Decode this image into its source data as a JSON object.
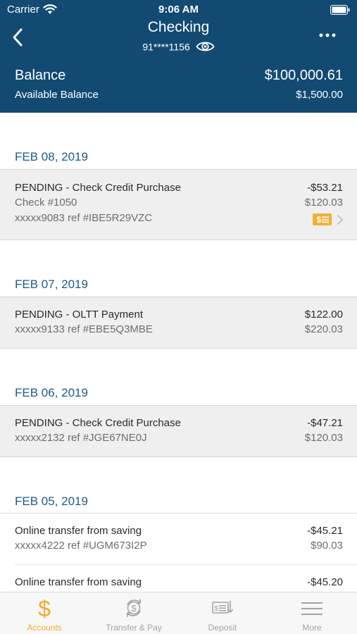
{
  "status_bar": {
    "carrier": "Carrier",
    "time": "9:06 AM"
  },
  "nav": {
    "title": "Checking",
    "account_number": "91****1156"
  },
  "balance": {
    "label": "Balance",
    "value": "$100,000.61",
    "available_label": "Available Balance",
    "available_value": "$1,500.00"
  },
  "groups": [
    {
      "date": "FEB 08, 2019",
      "transactions": [
        {
          "title": "PENDING - Check Credit Purchase",
          "amount": "-$53.21",
          "check": "Check #1050",
          "balance": "$120.03",
          "ref": "xxxxx9083 ref #IBE5R29VZC"
        }
      ]
    },
    {
      "date": "FEB 07, 2019",
      "transactions": [
        {
          "title": "PENDING - OLTT Payment",
          "amount": "$122.00",
          "ref": "xxxxx9133 ref #EBE5Q3MBE",
          "balance": "$220.03"
        }
      ]
    },
    {
      "date": "FEB 06, 2019",
      "transactions": [
        {
          "title": "PENDING - Check Credit Purchase",
          "amount": "-$47.21",
          "ref": "xxxxx2132 ref #JGE67NE0J",
          "balance": "$120.03"
        }
      ]
    },
    {
      "date": "FEB 05, 2019",
      "transactions": [
        {
          "title": "Online transfer from saving",
          "amount": "-$45.21",
          "ref": "xxxxx4222 ref #UGM673I2P",
          "balance": "$90.03"
        },
        {
          "title": "Online transfer from saving",
          "amount": "-$45.20"
        }
      ]
    }
  ],
  "tabs": [
    {
      "label": "Accounts",
      "icon": "dollar-icon",
      "active": true
    },
    {
      "label": "Transfer & Pay",
      "icon": "transfer-icon",
      "active": false
    },
    {
      "label": "Deposit",
      "icon": "check-deposit-icon",
      "active": false
    },
    {
      "label": "More",
      "icon": "menu-icon",
      "active": false
    }
  ],
  "colors": {
    "header": "#124a72",
    "date_text": "#1e5a85",
    "active_tab": "#f2ab30",
    "inactive_tab": "#a4a4a4",
    "pending_bg": "#efefef"
  }
}
